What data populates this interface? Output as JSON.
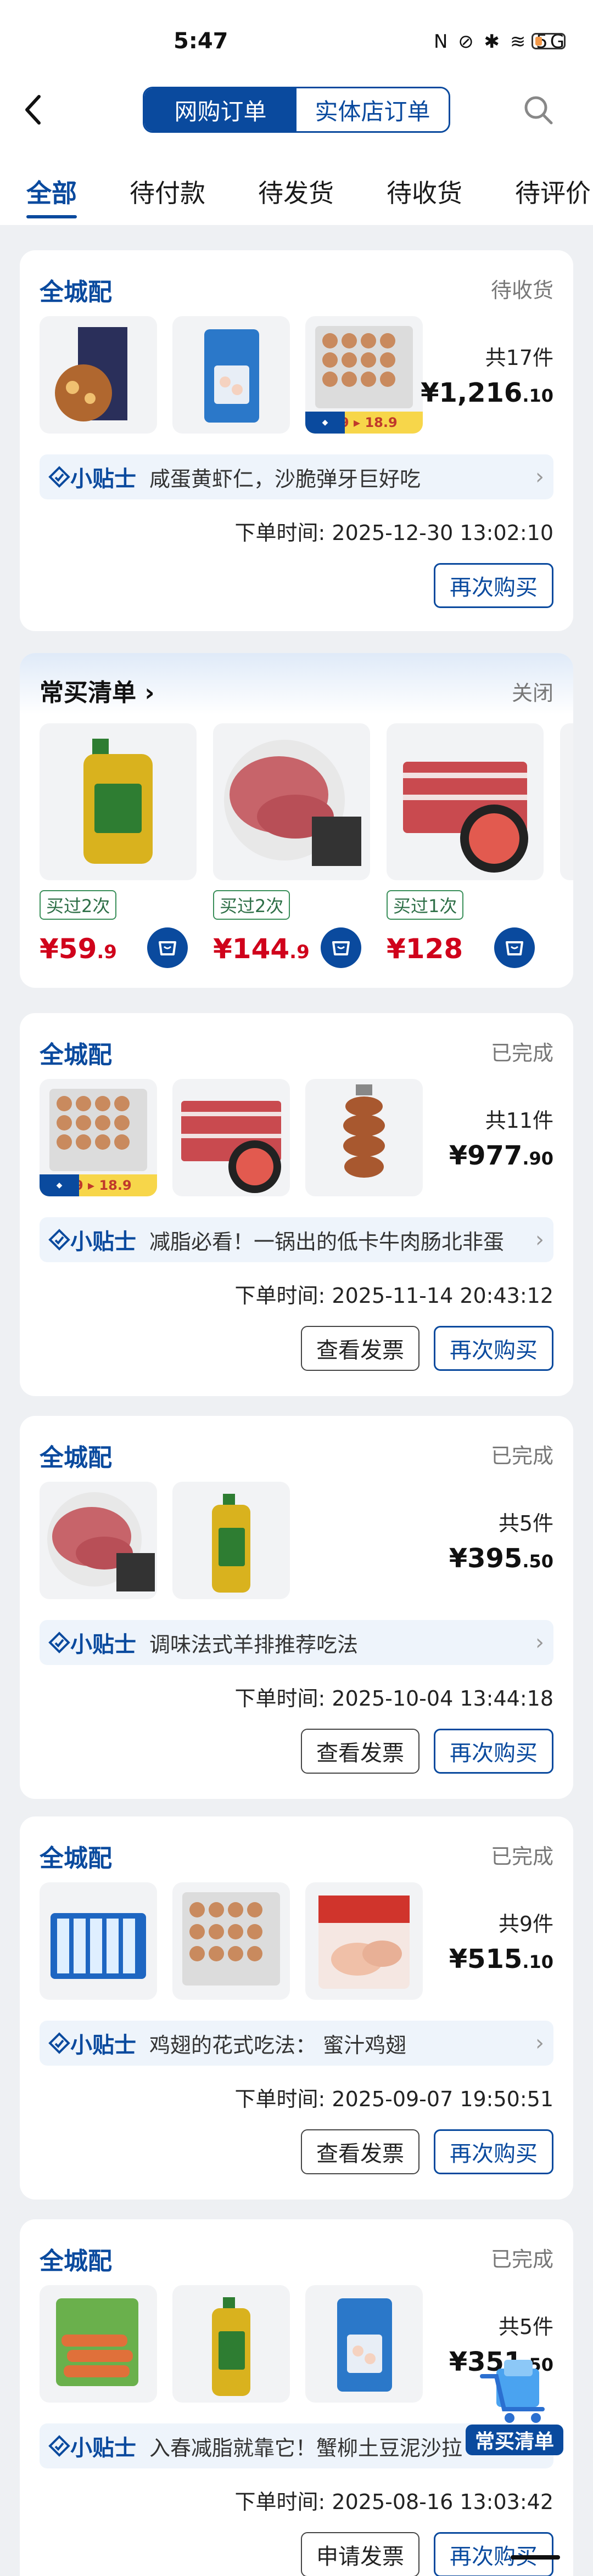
{
  "status_bar": {
    "time": "5:47",
    "icons_text": "N ⊘ ✱ ≋ 5G"
  },
  "header": {
    "segment_online": "网购订单",
    "segment_store": "实体店订单"
  },
  "tabs": [
    "全部",
    "待付款",
    "待发货",
    "待收货",
    "待评价"
  ],
  "frequent": {
    "title": "常买清单",
    "close": "关闭",
    "items": [
      {
        "bought": "买过2次",
        "price_main": "¥59",
        "price_dec": ".9"
      },
      {
        "bought": "买过2次",
        "price_main": "¥144",
        "price_dec": ".9"
      },
      {
        "bought": "买过1次",
        "price_main": "¥128",
        "price_dec": ""
      }
    ]
  },
  "orders": [
    {
      "title": "全城配",
      "status": "待收货",
      "count": "共17件",
      "price_main": "¥1,216",
      "price_dec": ".10",
      "tip_badge": "小贴士",
      "tip": "咸蛋黄虾仁，沙脆弹牙巨好吃",
      "time": "下单时间: 2025-12-30 13:02:10",
      "buttons": [
        "再次购买"
      ]
    },
    {
      "title": "全城配",
      "status": "已完成",
      "count": "共11件",
      "price_main": "¥977",
      "price_dec": ".90",
      "tip_badge": "小贴士",
      "tip": "减脂必看！一锅出的低卡牛肉肠北非蛋",
      "time": "下单时间: 2025-11-14 20:43:12",
      "buttons": [
        "查看发票",
        "再次购买"
      ]
    },
    {
      "title": "全城配",
      "status": "已完成",
      "count": "共5件",
      "price_main": "¥395",
      "price_dec": ".50",
      "tip_badge": "小贴士",
      "tip": "调味法式羊排推荐吃法",
      "time": "下单时间: 2025-10-04 13:44:18",
      "buttons": [
        "查看发票",
        "再次购买"
      ]
    },
    {
      "title": "全城配",
      "status": "已完成",
      "count": "共9件",
      "price_main": "¥515",
      "price_dec": ".10",
      "tip_badge": "小贴士",
      "tip": "鸡翅的花式吃法：  蜜汁鸡翅",
      "time": "下单时间: 2025-09-07 19:50:51",
      "buttons": [
        "查看发票",
        "再次购买"
      ]
    },
    {
      "title": "全城配",
      "status": "已完成",
      "count": "共5件",
      "price_main": "¥351",
      "price_dec": ".50",
      "tip_badge": "小贴士",
      "tip": "入春减脂就靠它！蟹柳土豆泥沙拉",
      "time": "下单时间: 2025-08-16 13:03:42",
      "buttons": [
        "申请发票",
        "再次购买"
      ]
    }
  ],
  "promo_strip": {
    "price_a": "19",
    "price_b": "18.9"
  },
  "float_button": "常买清单",
  "colors": {
    "brand_blue": "#0a4a9e",
    "price_red": "#d0021b",
    "tag_green": "#2e6f47"
  }
}
